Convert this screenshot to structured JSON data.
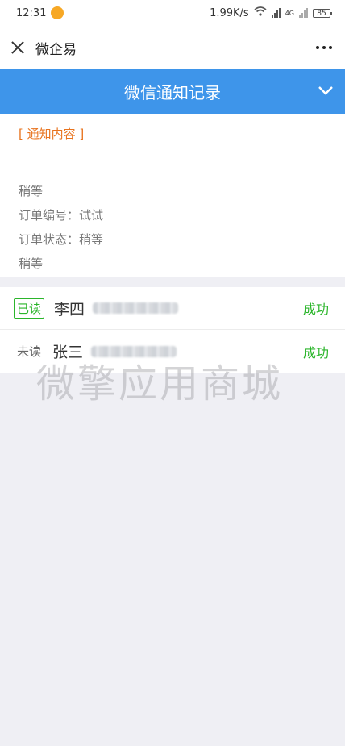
{
  "status_bar": {
    "time": "12:31",
    "net_speed": "1.99K/s",
    "network": "4G",
    "battery": "85"
  },
  "title_bar": {
    "title": "微企易"
  },
  "header": {
    "title": "微信通知记录",
    "color": "#3e95ea"
  },
  "notice": {
    "section_label": "[ 通知内容 ]",
    "lines": [
      "稍等",
      "订单编号：试试",
      "订单状态：稍等",
      "稍等"
    ]
  },
  "recipients": [
    {
      "read_status": "已读",
      "name": "李四",
      "result": "成功"
    },
    {
      "read_status": "未读",
      "name": "张三",
      "result": "成功"
    }
  ],
  "watermark": "微擎应用商城",
  "colors": {
    "success": "#2bb52b",
    "accent_orange": "#e8731e"
  }
}
